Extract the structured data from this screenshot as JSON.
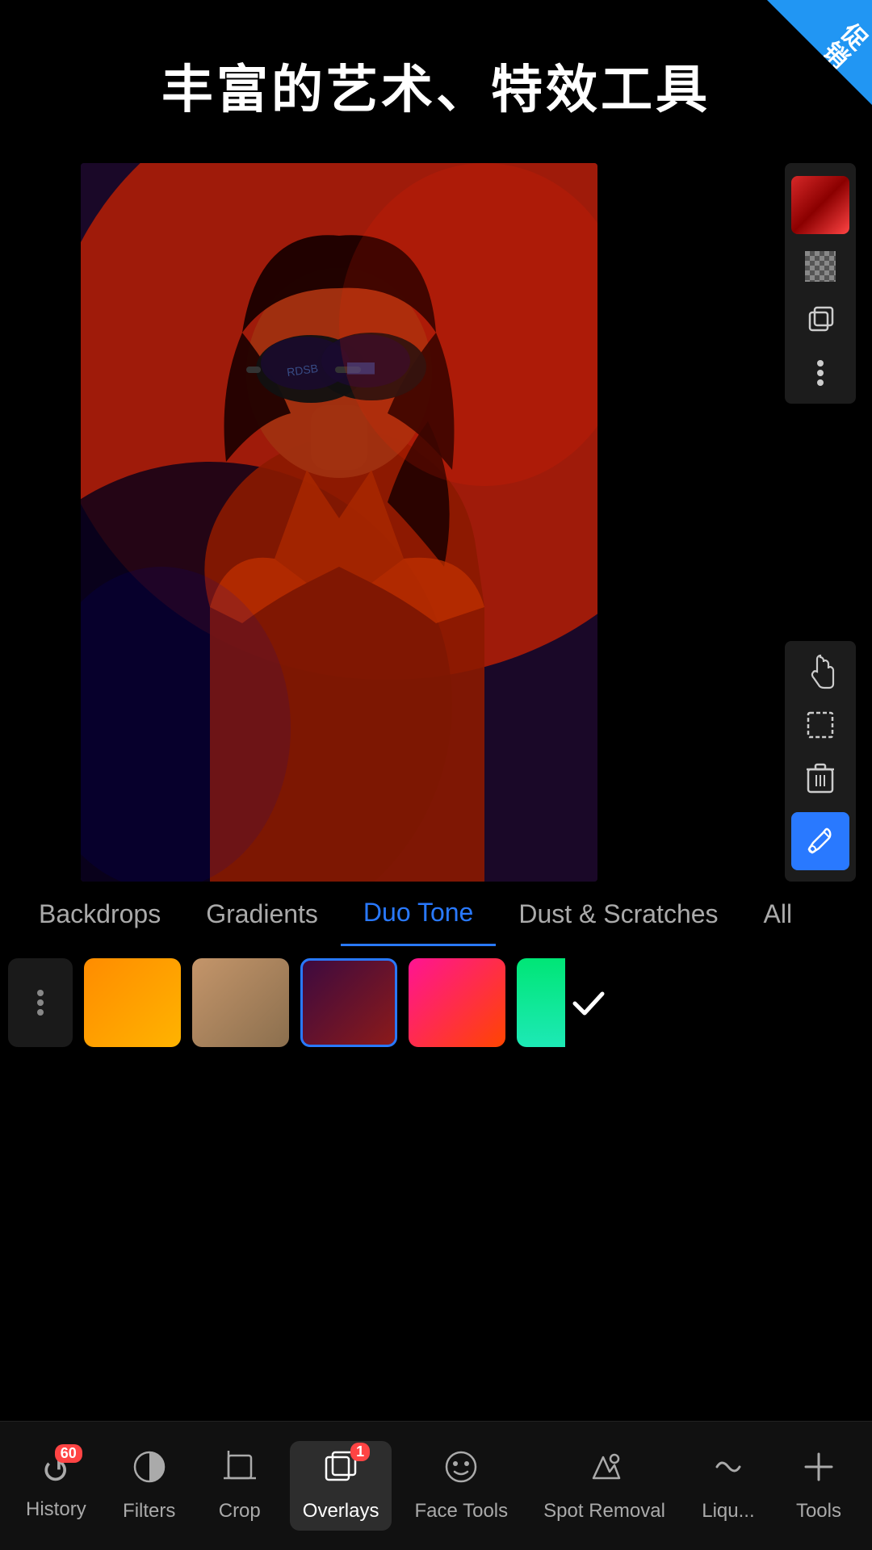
{
  "corner_badge": {
    "text": "促销"
  },
  "page_title": "丰富的艺术、特效工具",
  "canvas": {
    "photo_alt": "Woman with sunglasses under red/blue duotone effect"
  },
  "toolbar": {
    "color_swatch_label": "Color swatch",
    "icons": [
      {
        "name": "checkerboard",
        "symbol": "⊞"
      },
      {
        "name": "duplicate",
        "symbol": "⧉"
      },
      {
        "name": "more",
        "symbol": "⋮"
      },
      {
        "name": "hand",
        "symbol": "✋"
      },
      {
        "name": "selection",
        "symbol": "⬚"
      },
      {
        "name": "delete",
        "symbol": "🗑"
      },
      {
        "name": "eyedropper",
        "symbol": "💉"
      }
    ]
  },
  "overlay_tabs": {
    "items": [
      {
        "label": "Backdrops",
        "active": false
      },
      {
        "label": "Gradients",
        "active": false
      },
      {
        "label": "Duo Tone",
        "active": true
      },
      {
        "label": "Dust & Scratches",
        "active": false
      },
      {
        "label": "All",
        "active": false
      }
    ]
  },
  "swatches": [
    {
      "type": "options",
      "label": "⋮"
    },
    {
      "type": "color",
      "gradient": "linear-gradient(135deg, #FF8C00, #FFB300)",
      "selected": false
    },
    {
      "type": "color",
      "gradient": "linear-gradient(135deg, #C4956A, #8B6F4E)",
      "selected": false
    },
    {
      "type": "color",
      "gradient": "linear-gradient(135deg, #3d0a3f, #8b1a1a)",
      "selected": true
    },
    {
      "type": "color",
      "gradient": "linear-gradient(135deg, #FF1493, #FF4500)",
      "selected": false
    },
    {
      "type": "color",
      "gradient": "linear-gradient(135deg, #00E676, #1DE9B6)",
      "selected": false,
      "partial": true
    }
  ],
  "bottom_nav": {
    "items": [
      {
        "id": "history",
        "label": "History",
        "icon": "↺",
        "badge": "60",
        "active": false
      },
      {
        "id": "filters",
        "label": "Filters",
        "icon": "◑",
        "badge": null,
        "active": false
      },
      {
        "id": "crop",
        "label": "Crop",
        "icon": "⊡",
        "badge": null,
        "active": false
      },
      {
        "id": "overlays",
        "label": "Overlays",
        "icon": "⧉",
        "badge": "1",
        "active": true
      },
      {
        "id": "face-tools",
        "label": "Face Tools",
        "icon": "☺",
        "badge": null,
        "active": false
      },
      {
        "id": "spot-removal",
        "label": "Spot Removal",
        "icon": "✂",
        "badge": null,
        "active": false
      },
      {
        "id": "liquify",
        "label": "Liqu...",
        "icon": "〜",
        "badge": null,
        "active": false
      },
      {
        "id": "tools",
        "label": "Tools",
        "icon": "+",
        "badge": null,
        "active": false
      }
    ]
  }
}
